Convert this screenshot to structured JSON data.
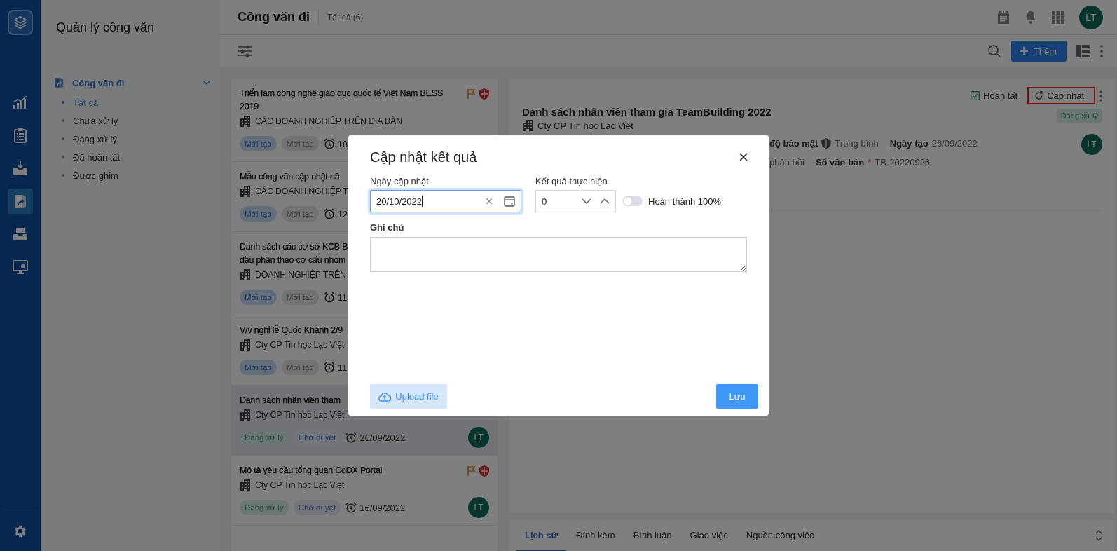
{
  "rail": [
    {
      "kind": "chart",
      "selected": false
    },
    {
      "kind": "clipboard",
      "selected": false
    },
    {
      "kind": "inbox",
      "selected": false
    },
    {
      "kind": "outbox",
      "selected": true
    },
    {
      "kind": "tray",
      "selected": false
    },
    {
      "kind": "monitor",
      "selected": false
    },
    {
      "kind": "settings",
      "selected": false
    }
  ],
  "sidebar": {
    "title": "Quản lý công văn",
    "group": {
      "label": "Công văn đi",
      "expanded": true,
      "items": [
        {
          "label": "Tất cả",
          "selected": true
        },
        {
          "label": "Chưa xử lý",
          "selected": false
        },
        {
          "label": "Đang xử lý",
          "selected": false
        },
        {
          "label": "Đã hoàn tất",
          "selected": false
        },
        {
          "label": "Được ghim",
          "selected": false
        }
      ]
    }
  },
  "header": {
    "title": "Công văn đi",
    "count": "Tất cả (6)",
    "avatar": "LT"
  },
  "toolbar": {
    "add_button": "Thêm"
  },
  "list": [
    {
      "title_lines": [
        "Triển lãm công nghệ giáo dục quốc tế Việt Nam BESS 2019"
      ],
      "flagged": true,
      "secure": true,
      "org": "CÁC DOANH NGHIỆP TRÊN ĐỊA BÀN",
      "tags": [
        {
          "label": "Mới tạo",
          "kind": "new"
        },
        {
          "label": "Mới tạo",
          "kind": "draft"
        }
      ],
      "date": "18",
      "selected": false
    },
    {
      "title_lines": [
        "Mẫu công văn cập nhật nă"
      ],
      "org": "CÁC DOANH NGHIỆP T",
      "tags": [
        {
          "label": "Mới tạo",
          "kind": "new"
        },
        {
          "label": "Mới tạo",
          "kind": "draft"
        }
      ],
      "date": "12",
      "selected": false
    },
    {
      "title_lines": [
        "Danh sách các cơ sở KCB B",
        "đầu phân theo cơ cấu nhóm"
      ],
      "org": "DOANH NGHIỆP TRÊN",
      "tags": [
        {
          "label": "Mới tạo",
          "kind": "new"
        },
        {
          "label": "Mới tạo",
          "kind": "draft"
        }
      ],
      "date": "11",
      "selected": false
    },
    {
      "title_lines": [
        "V/v nghỉ lễ Quốc Khánh 2/9"
      ],
      "org": "Cty CP Tin học Lạc Việt",
      "tags": [
        {
          "label": "Mới tạo",
          "kind": "new"
        },
        {
          "label": "Mới tạo",
          "kind": "draft"
        }
      ],
      "date": "11",
      "selected": false
    },
    {
      "title_lines": [
        "Danh sách nhân viên tham"
      ],
      "org": "Cty CP Tin học Lạc Việt",
      "tags": [
        {
          "label": "Đang xử lý",
          "kind": "processing"
        },
        {
          "label": "Chờ duyệt",
          "kind": "pending"
        }
      ],
      "date": "26/09/2022",
      "avatar": "LT",
      "selected": true
    },
    {
      "title_lines": [
        "Mô tả yêu cầu tổng quan CoDX Portal"
      ],
      "flagged": true,
      "secure": true,
      "org": "Cty CP Tin học Lạc Việt",
      "tags": [
        {
          "label": "Đang xử lý",
          "kind": "processing"
        },
        {
          "label": "Chờ duyệt",
          "kind": "pending"
        }
      ],
      "date": "16/09/2022",
      "avatar": "LT",
      "selected": false
    }
  ],
  "detail": {
    "actions": [
      {
        "label": "Hoàn tất",
        "kind": "complete",
        "highlighted": false
      },
      {
        "label": "Cập nhật",
        "kind": "update",
        "highlighted": true
      }
    ],
    "title": "Danh sách nhân viên tham gia TeamBuilding 2022",
    "org": "Cty CP Tin học Lạc Việt",
    "status": "Đang xử lý",
    "avatar": "LT",
    "field_rows": [
      [
        {
          "label": "độ bảo mật",
          "kind": "security",
          "value": "Trung bình"
        },
        {
          "label": "Ngày tạo",
          "value": "26/09/2022"
        }
      ],
      [
        {
          "value": "phản hồi"
        },
        {
          "label": "Số văn bản",
          "mark": "*",
          "value": "TB-20220926"
        }
      ]
    ]
  },
  "tabs": [
    {
      "label": "Lịch sử",
      "selected": true
    },
    {
      "label": "Đính kèm",
      "selected": false
    },
    {
      "label": "Bình luận",
      "selected": false
    },
    {
      "label": "Giao việc",
      "selected": false
    },
    {
      "label": "Nguồn công việc",
      "selected": false
    }
  ],
  "modal": {
    "title": "Cập nhật kết quả",
    "date_label": "Ngày cập nhật",
    "date_value": "20/10/2022",
    "result_label": "Kết quả thực hiện",
    "result_value": "0",
    "complete_toggle": {
      "label": "Hoàn thành 100%",
      "on": false
    },
    "note_label": "Ghi chú",
    "upload_button": "Upload file",
    "save_button": "Lưu"
  }
}
